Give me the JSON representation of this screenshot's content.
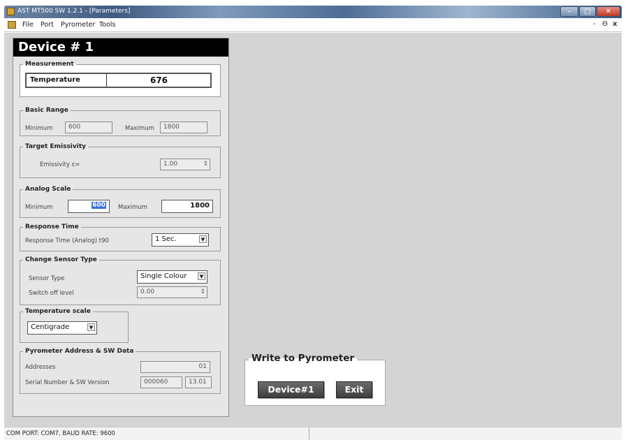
{
  "window": {
    "title": "AST MT500 SW 1.2.1 - [Parameters]",
    "controls": {
      "minimize": "–",
      "maximize": "□",
      "close": "✕"
    }
  },
  "menu": {
    "items": [
      "File",
      "Port",
      "Pyrometer",
      "Tools"
    ],
    "mdi_controls": {
      "minimize": "-",
      "restore": "Θ",
      "close": "x"
    }
  },
  "device": {
    "header": "Device # 1",
    "measurement": {
      "legend": "Measurement",
      "label": "Temperature",
      "value": "676"
    },
    "basic_range": {
      "legend": "Basic Range",
      "min_label": "Minimum",
      "min_value": "600",
      "max_label": "Maximum",
      "max_value": "1800"
    },
    "target_emissivity": {
      "legend": "Target Emissivity",
      "label": "Emissivity ε=",
      "value": "1.00"
    },
    "analog_scale": {
      "legend": "Analog Scale",
      "min_label": "Minimum",
      "min_value": "600",
      "max_label": "Maximum",
      "max_value": "1800"
    },
    "response_time": {
      "legend": "Response Time",
      "label": "Response Time (Analog) t90",
      "value": "1 Sec."
    },
    "sensor_type": {
      "legend": "Change Sensor Type",
      "type_label": "Sensor Type",
      "type_value": "Single Colour",
      "switch_label": "Switch off level",
      "switch_value": "0.00"
    },
    "temperature_scale": {
      "legend": "Temperature scale",
      "value": "Centigrade"
    },
    "address_data": {
      "legend": "Pyrometer Address & SW Data",
      "addresses_label": "Addresses",
      "addresses_value": "01",
      "serial_label": "Serial Number & SW Version",
      "serial_value": "000060",
      "sw_version": "13.01"
    }
  },
  "write_panel": {
    "title": "Write to Pyrometer",
    "device_button": "Device#1",
    "exit_button": "Exit"
  },
  "status": {
    "text": "COM PORT: COM7,  BAUD RATE: 9600"
  }
}
